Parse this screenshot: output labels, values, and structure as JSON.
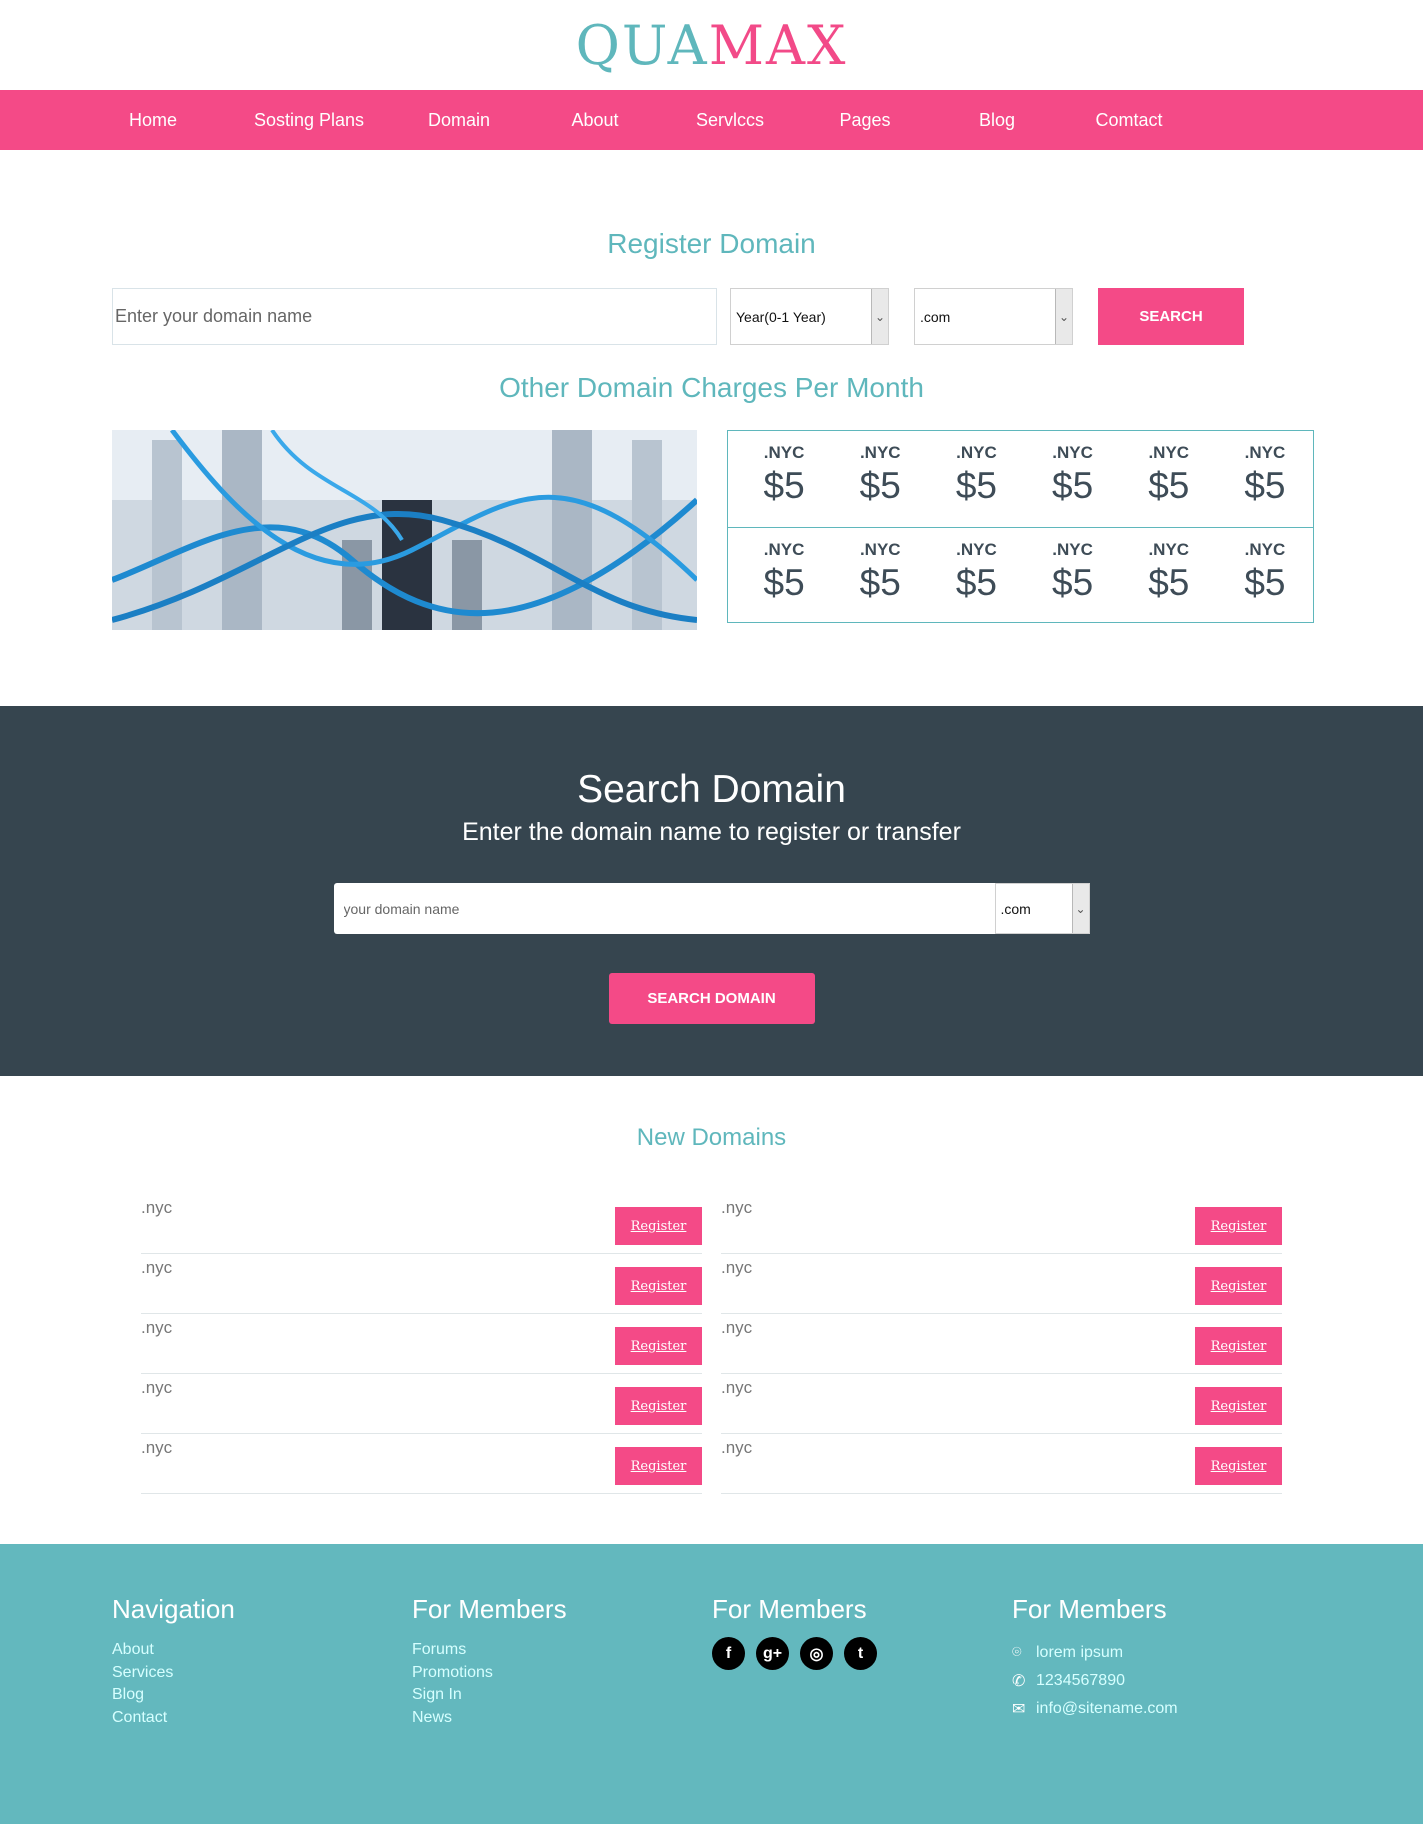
{
  "header": {
    "logo_part1": "QUA",
    "logo_part2": "MAX"
  },
  "nav": {
    "items": [
      "Home",
      "Sosting Plans",
      "Domain",
      "About",
      "Servlccs",
      "Pages",
      "Blog",
      "Comtact"
    ]
  },
  "register": {
    "title": "Register Domain",
    "input_placeholder": "Enter your domain name",
    "year_select": "Year(0-1 Year)",
    "tld_select": ".com",
    "search_label": "SEARCH"
  },
  "charges": {
    "title": "Other Domain Charges Per Month",
    "rows": [
      [
        {
          "tld": ".NYC",
          "price": "$5"
        },
        {
          "tld": ".NYC",
          "price": "$5"
        },
        {
          "tld": ".NYC",
          "price": "$5"
        },
        {
          "tld": ".NYC",
          "price": "$5"
        },
        {
          "tld": ".NYC",
          "price": "$5"
        },
        {
          "tld": ".NYC",
          "price": "$5"
        }
      ],
      [
        {
          "tld": ".NYC",
          "price": "$5"
        },
        {
          "tld": ".NYC",
          "price": "$5"
        },
        {
          "tld": ".NYC",
          "price": "$5"
        },
        {
          "tld": ".NYC",
          "price": "$5"
        },
        {
          "tld": ".NYC",
          "price": "$5"
        },
        {
          "tld": ".NYC",
          "price": "$5"
        }
      ]
    ]
  },
  "search": {
    "title": "Search Domain",
    "subtitle": "Enter the domain name to register or transfer",
    "input_placeholder": "your domain name",
    "tld_select": ".com",
    "button_label": "SEARCH DOMAIN"
  },
  "new_domains": {
    "title": "New Domains",
    "register_label": "Register",
    "left": [
      ".nyc",
      ".nyc",
      ".nyc",
      ".nyc",
      ".nyc"
    ],
    "right": [
      ".nyc",
      ".nyc",
      ".nyc",
      ".nyc",
      ".nyc"
    ]
  },
  "footer": {
    "navigation": {
      "title": "Navigation",
      "links": [
        "About",
        "Services",
        "Blog",
        "Contact"
      ]
    },
    "members1": {
      "title": "For Members",
      "links": [
        "Forums",
        "Promotions",
        "Sign In",
        "News"
      ]
    },
    "members2": {
      "title": "For Members",
      "socials": [
        {
          "icon": "facebook-icon",
          "glyph": "f"
        },
        {
          "icon": "google-plus-icon",
          "glyph": "g+"
        },
        {
          "icon": "instagram-icon",
          "glyph": "◎"
        },
        {
          "icon": "twitter-icon",
          "glyph": "t"
        }
      ]
    },
    "members3": {
      "title": "For Members",
      "address": "lorem ipsum",
      "phone": "1234567890",
      "email": "info@sitename.com"
    }
  },
  "colors": {
    "accent_pink": "#f44a87",
    "accent_teal": "#5fb7bc",
    "dark_band": "#36454f",
    "footer_bg": "#63b8be"
  }
}
